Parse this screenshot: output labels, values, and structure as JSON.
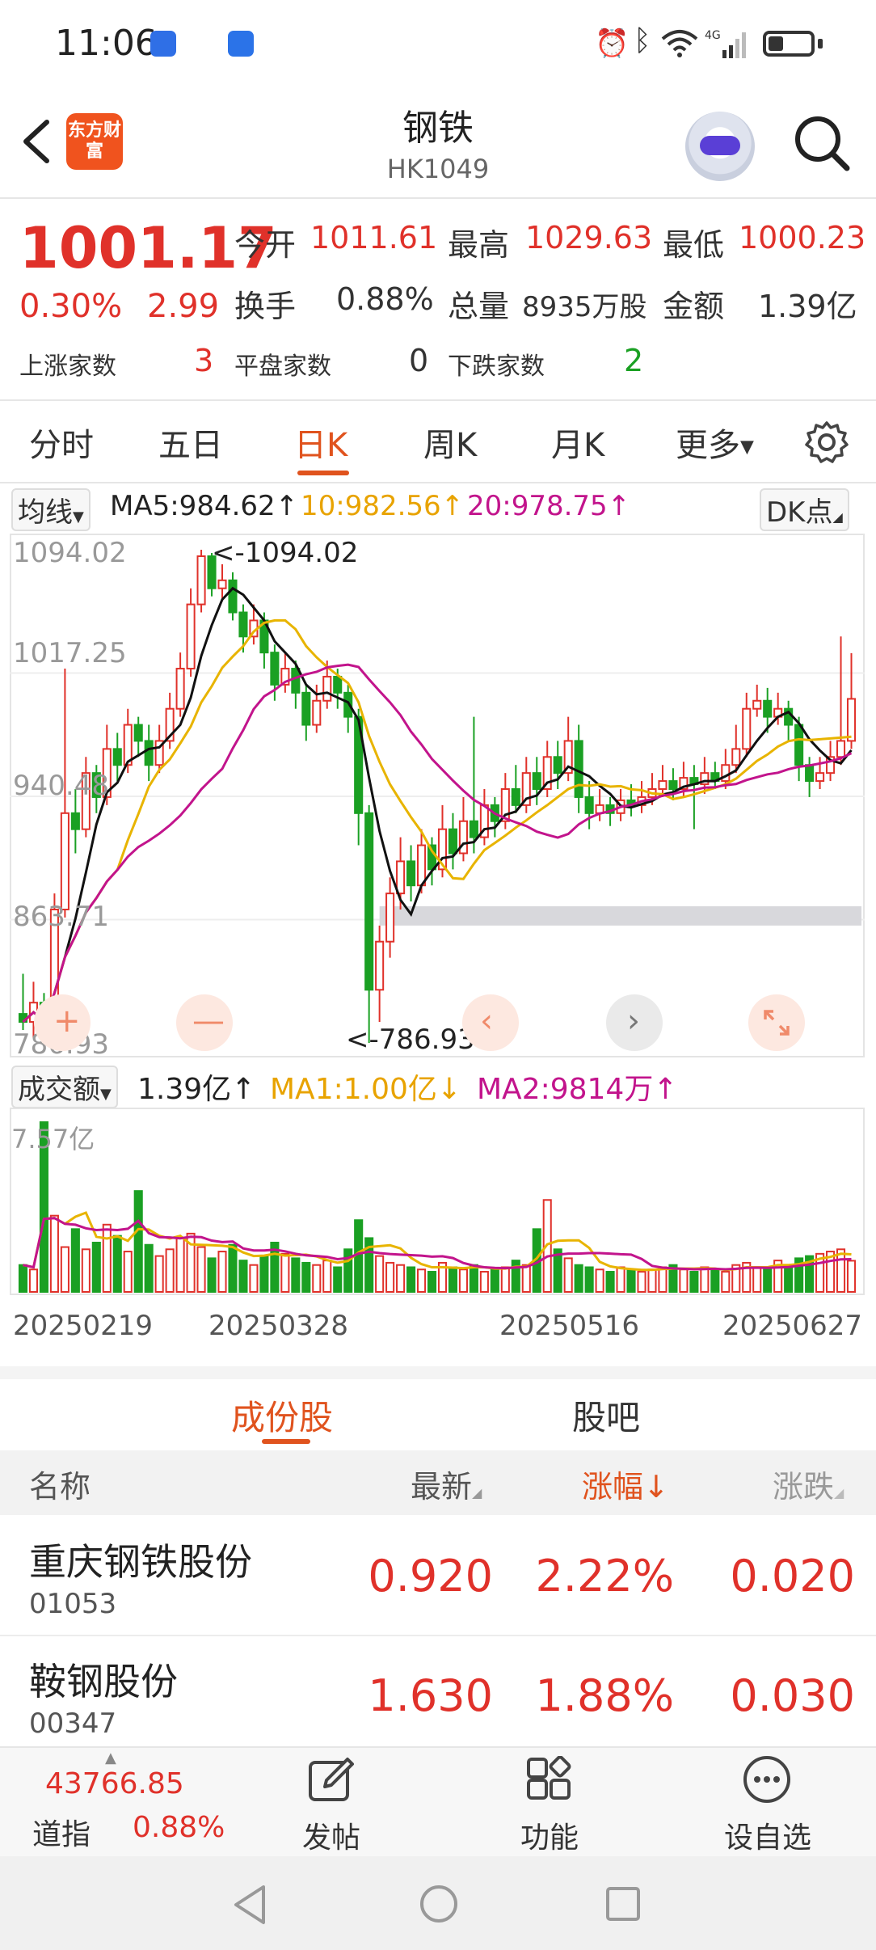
{
  "status": {
    "time": "11:06"
  },
  "header": {
    "title": "钢铁",
    "code": "HK1049",
    "logo_text": "东方财富"
  },
  "quote": {
    "price": "1001.17",
    "change_pct": "0.30%",
    "change": "2.99",
    "open_label": "今开",
    "open": "1011.61",
    "high_label": "最高",
    "high": "1029.63",
    "low_label": "最低",
    "low": "1000.23",
    "turnover_label": "换手",
    "turnover": "0.88%",
    "volume_label": "总量",
    "volume": "8935万股",
    "amount_label": "金额",
    "amount": "1.39亿",
    "up_label": "上涨家数",
    "up": "3",
    "flat_label": "平盘家数",
    "flat": "0",
    "down_label": "下跌家数",
    "down": "2"
  },
  "tabs": [
    "分时",
    "五日",
    "日K",
    "周K",
    "月K",
    "更多"
  ],
  "active_tab": "日K",
  "ma": {
    "selector": "均线",
    "ma5": "MA5:984.62↑",
    "ma10": "10:982.56↑",
    "ma20": "20:978.75↑",
    "dk": "DK点"
  },
  "volume_header": {
    "selector": "成交额",
    "value": "1.39亿↑",
    "ma1": "MA1:1.00亿↓",
    "ma2": "MA2:9814万↑",
    "max_label": "7.57亿"
  },
  "chart_data": {
    "type": "candlestick",
    "y_ticks": [
      "1094.02",
      "1017.25",
      "940.48",
      "863.71",
      "786.93"
    ],
    "ylim": [
      786.93,
      1094.02
    ],
    "high_marker": "<-1094.02",
    "low_marker": "<-786.93",
    "dates": [
      "20250219",
      "20250328",
      "20250516",
      "20250627"
    ],
    "candles": [
      [
        805,
        800,
        830,
        795
      ],
      [
        800,
        812,
        825,
        790
      ],
      [
        812,
        790,
        818,
        786.93
      ],
      [
        790,
        870,
        880,
        788
      ],
      [
        870,
        930,
        1020,
        865
      ],
      [
        930,
        920,
        945,
        905
      ],
      [
        920,
        955,
        965,
        915
      ],
      [
        955,
        940,
        960,
        930
      ],
      [
        940,
        970,
        985,
        935
      ],
      [
        970,
        960,
        980,
        950
      ],
      [
        960,
        985,
        995,
        955
      ],
      [
        985,
        975,
        990,
        965
      ],
      [
        975,
        960,
        985,
        950
      ],
      [
        960,
        975,
        985,
        955
      ],
      [
        975,
        995,
        1005,
        970
      ],
      [
        995,
        1020,
        1030,
        990
      ],
      [
        1020,
        1060,
        1070,
        1015
      ],
      [
        1060,
        1090,
        1094.02,
        1055
      ],
      [
        1090,
        1070,
        1092,
        1065
      ],
      [
        1070,
        1075,
        1085,
        1062
      ],
      [
        1075,
        1055,
        1080,
        1050
      ],
      [
        1055,
        1040,
        1060,
        1030
      ],
      [
        1040,
        1050,
        1060,
        1035
      ],
      [
        1050,
        1030,
        1055,
        1020
      ],
      [
        1030,
        1010,
        1035,
        1000
      ],
      [
        1010,
        1020,
        1030,
        1005
      ],
      [
        1020,
        1005,
        1025,
        995
      ],
      [
        1005,
        985,
        1010,
        975
      ],
      [
        985,
        1000,
        1010,
        980
      ],
      [
        1000,
        1015,
        1025,
        995
      ],
      [
        1015,
        1005,
        1020,
        995
      ],
      [
        1005,
        990,
        1010,
        980
      ],
      [
        990,
        930,
        995,
        910
      ],
      [
        930,
        820,
        935,
        786.93
      ],
      [
        820,
        850,
        860,
        800
      ],
      [
        850,
        880,
        890,
        840
      ],
      [
        880,
        900,
        915,
        870
      ],
      [
        900,
        885,
        910,
        875
      ],
      [
        885,
        910,
        920,
        880
      ],
      [
        910,
        895,
        915,
        885
      ],
      [
        895,
        920,
        935,
        890
      ],
      [
        920,
        905,
        930,
        895
      ],
      [
        905,
        925,
        940,
        900
      ],
      [
        925,
        915,
        990,
        905
      ],
      [
        915,
        935,
        945,
        910
      ],
      [
        935,
        925,
        940,
        915
      ],
      [
        925,
        945,
        955,
        920
      ],
      [
        945,
        935,
        960,
        930
      ],
      [
        935,
        955,
        965,
        930
      ],
      [
        955,
        945,
        965,
        935
      ],
      [
        945,
        965,
        975,
        940
      ],
      [
        965,
        955,
        975,
        945
      ],
      [
        955,
        975,
        990,
        950
      ],
      [
        975,
        940,
        985,
        930
      ],
      [
        940,
        930,
        950,
        920
      ],
      [
        930,
        935,
        945,
        925
      ],
      [
        935,
        930,
        940,
        922
      ],
      [
        930,
        938,
        945,
        925
      ],
      [
        938,
        935,
        948,
        928
      ],
      [
        935,
        940,
        950,
        930
      ],
      [
        940,
        945,
        955,
        935
      ],
      [
        945,
        950,
        960,
        940
      ],
      [
        950,
        945,
        958,
        938
      ],
      [
        945,
        952,
        962,
        940
      ],
      [
        952,
        948,
        960,
        920
      ],
      [
        948,
        955,
        965,
        942
      ],
      [
        955,
        950,
        962,
        945
      ],
      [
        950,
        960,
        970,
        945
      ],
      [
        960,
        970,
        985,
        955
      ],
      [
        970,
        995,
        1005,
        965
      ],
      [
        995,
        1000,
        1010,
        990
      ],
      [
        1000,
        990,
        1008,
        980
      ],
      [
        990,
        995,
        1005,
        985
      ],
      [
        995,
        985,
        1000,
        975
      ],
      [
        985,
        960,
        990,
        950
      ],
      [
        960,
        950,
        965,
        940
      ],
      [
        950,
        955,
        965,
        945
      ],
      [
        955,
        965,
        975,
        950
      ],
      [
        965,
        975,
        1040,
        960
      ],
      [
        975,
        1001.17,
        1029.63,
        970
      ]
    ],
    "volume": [
      1.2,
      1.0,
      7.57,
      3.4,
      2.0,
      2.8,
      1.9,
      2.2,
      3.0,
      2.5,
      1.8,
      4.5,
      2.1,
      1.6,
      1.9,
      2.4,
      2.6,
      2.0,
      1.5,
      1.8,
      2.1,
      1.4,
      1.2,
      1.6,
      2.2,
      1.7,
      1.5,
      1.3,
      1.2,
      1.4,
      1.1,
      1.9,
      3.2,
      2.4,
      1.6,
      1.3,
      1.2,
      1.1,
      1.0,
      0.9,
      1.3,
      1.1,
      1.0,
      1.2,
      0.9,
      1.0,
      1.1,
      1.4,
      1.2,
      2.8,
      4.1,
      1.9,
      1.5,
      1.2,
      1.1,
      1.0,
      0.9,
      1.1,
      1.0,
      0.9,
      1.0,
      1.1,
      1.2,
      1.0,
      0.9,
      1.1,
      1.0,
      0.9,
      1.2,
      1.3,
      1.1,
      1.0,
      1.4,
      1.2,
      1.5,
      1.6,
      1.7,
      1.8,
      1.9,
      1.39
    ]
  },
  "list_tabs": [
    "成份股",
    "股吧"
  ],
  "list_header": {
    "name": "名称",
    "latest": "最新",
    "change_pct": "涨幅↓",
    "change": "涨跌"
  },
  "rows": [
    {
      "name": "重庆钢铁股份",
      "code": "01053",
      "latest": "0.920",
      "pct": "2.22%",
      "chg": "0.020"
    },
    {
      "name": "鞍钢股份",
      "code": "00347",
      "latest": "1.630",
      "pct": "1.88%",
      "chg": "0.030"
    }
  ],
  "bottom": {
    "index_value": "43766.85",
    "index_name": "道指",
    "index_pct": "0.88%",
    "post": "发帖",
    "func": "功能",
    "watch": "设自选"
  }
}
